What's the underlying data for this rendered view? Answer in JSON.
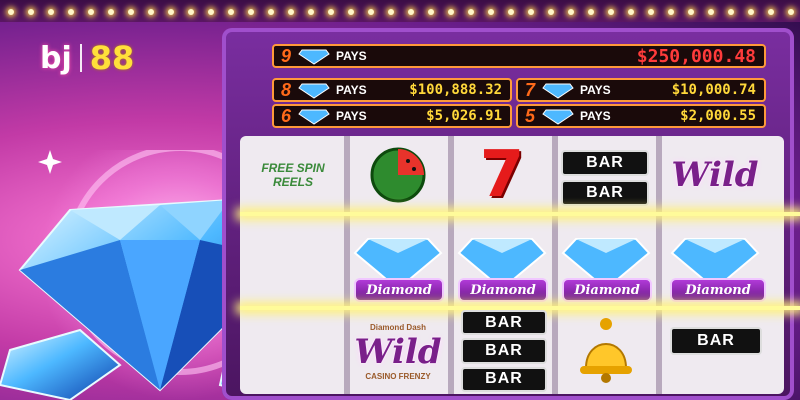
{
  "brand": {
    "bj": "bj",
    "num": "88"
  },
  "paytable": {
    "top": {
      "count": "9",
      "gem_label": "Diamond",
      "pays_label": "PAYS",
      "amount": "$250,000.48"
    },
    "rows": [
      {
        "count": "8",
        "pays_label": "PAYS",
        "amount": "$100,888.32"
      },
      {
        "count": "7",
        "pays_label": "PAYS",
        "amount": "$10,000.74"
      },
      {
        "count": "6",
        "pays_label": "PAYS",
        "amount": "$5,026.91"
      },
      {
        "count": "5",
        "pays_label": "PAYS",
        "amount": "$2,000.55"
      }
    ]
  },
  "reels": {
    "bar_label": "BAR",
    "wild_label": "Wild",
    "wild_top_caption": "Diamond Dash",
    "wild_bottom_caption": "CASINO FRENZY",
    "diamond_label": "Diamond",
    "free_spins_partial": "FREE SPIN REELS"
  },
  "colors": {
    "bg_pink": "#ff7fd8",
    "frame_purple": "#7a2ea0",
    "paytable_border": "#ff9a3a",
    "amount_red": "#ff3b3b",
    "payline_glow": "#fffb9a",
    "diamond_blue": "#2f9bff"
  },
  "icons": [
    "diamond-icon",
    "watermelon-icon",
    "seven-icon",
    "bell-icon",
    "wild-icon",
    "bar-icon"
  ]
}
